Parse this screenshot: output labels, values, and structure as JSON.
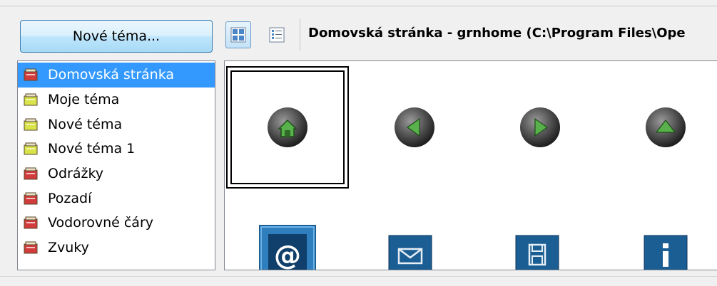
{
  "toolbar": {
    "new_theme_label": "Nové téma...",
    "path_text": "Domovská stránka - grnhome (C:\\Program Files\\Ope"
  },
  "themes": [
    {
      "label": "Domovská stránka",
      "color": "red",
      "selected": true
    },
    {
      "label": "Moje téma",
      "color": "yellow",
      "selected": false
    },
    {
      "label": "Nové téma",
      "color": "yellow",
      "selected": false
    },
    {
      "label": "Nové téma 1",
      "color": "yellow",
      "selected": false
    },
    {
      "label": "Odrážky",
      "color": "red",
      "selected": false
    },
    {
      "label": "Pozadí",
      "color": "red",
      "selected": false
    },
    {
      "label": "Vodorovné čáry",
      "color": "red",
      "selected": false
    },
    {
      "label": "Zvuky",
      "color": "red",
      "selected": false
    }
  ],
  "icons": [
    {
      "name": "home-ball-icon",
      "selected": true
    },
    {
      "name": "back-ball-icon",
      "selected": false
    },
    {
      "name": "forward-ball-icon",
      "selected": false
    },
    {
      "name": "up-ball-icon",
      "selected": false
    },
    {
      "name": "email-at-icon",
      "selected": false
    },
    {
      "name": "mail-envelope-icon",
      "selected": false
    },
    {
      "name": "save-disk-icon",
      "selected": false
    },
    {
      "name": "info-icon",
      "selected": false
    }
  ],
  "colors": {
    "selection": "#3399ff",
    "folder_red": "#d23b3b",
    "folder_yellow": "#d9e34a",
    "ball_green": "#58b14a",
    "tile_blue": "#1b5e93"
  }
}
